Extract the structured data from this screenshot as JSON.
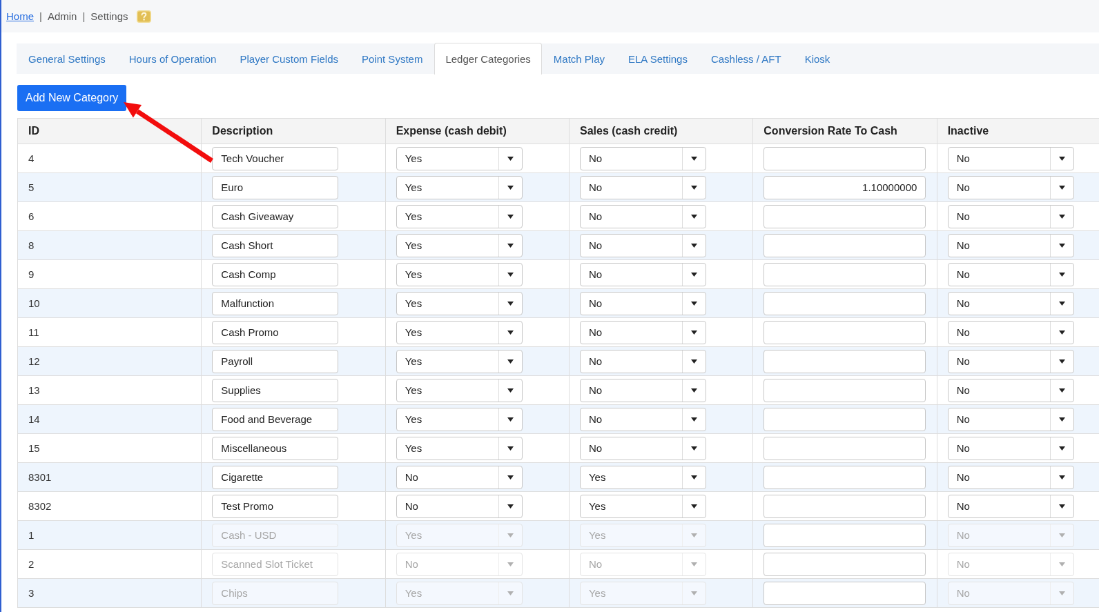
{
  "breadcrumb": [
    {
      "kind": "link",
      "label": "Home"
    },
    {
      "kind": "separator",
      "label": "|"
    },
    {
      "kind": "text",
      "label": "Admin"
    },
    {
      "kind": "separator",
      "label": "|"
    },
    {
      "kind": "text",
      "label": "Settings"
    },
    {
      "kind": "help"
    }
  ],
  "tabs": [
    {
      "label": "General Settings",
      "selected": false
    },
    {
      "label": "Hours of Operation",
      "selected": false
    },
    {
      "label": "Player Custom Fields",
      "selected": false
    },
    {
      "label": "Point System",
      "selected": false
    },
    {
      "label": "Ledger Categories",
      "selected": true
    },
    {
      "label": "Match Play",
      "selected": false
    },
    {
      "label": "ELA Settings",
      "selected": false
    },
    {
      "label": "Cashless / AFT",
      "selected": false
    },
    {
      "label": "Kiosk",
      "selected": false
    }
  ],
  "add_button": {
    "label": "Add New Category"
  },
  "table": {
    "columns": [
      "ID",
      "Description",
      "Expense (cash debit)",
      "Sales (cash credit)",
      "Conversion Rate To Cash",
      "Inactive"
    ],
    "rows": [
      {
        "id": "4",
        "description": "Tech Voucher",
        "expense": "Yes",
        "sales": "No",
        "inactive": "No",
        "disabled": false
      },
      {
        "id": "5",
        "description": "Euro",
        "expense": "Yes",
        "sales": "No",
        "conversion_rate": "1.10000000",
        "inactive": "No",
        "disabled": false
      },
      {
        "id": "6",
        "description": "Cash Giveaway",
        "expense": "Yes",
        "sales": "No",
        "inactive": "No",
        "disabled": false
      },
      {
        "id": "8",
        "description": "Cash Short",
        "expense": "Yes",
        "sales": "No",
        "inactive": "No",
        "disabled": false
      },
      {
        "id": "9",
        "description": "Cash Comp",
        "expense": "Yes",
        "sales": "No",
        "inactive": "No",
        "disabled": false
      },
      {
        "id": "10",
        "description": "Malfunction",
        "expense": "Yes",
        "sales": "No",
        "inactive": "No",
        "disabled": false
      },
      {
        "id": "11",
        "description": "Cash Promo",
        "expense": "Yes",
        "sales": "No",
        "inactive": "No",
        "disabled": false
      },
      {
        "id": "12",
        "description": "Payroll",
        "expense": "Yes",
        "sales": "No",
        "inactive": "No",
        "disabled": false
      },
      {
        "id": "13",
        "description": "Supplies",
        "expense": "Yes",
        "sales": "No",
        "inactive": "No",
        "disabled": false
      },
      {
        "id": "14",
        "description": "Food and Beverage",
        "expense": "Yes",
        "sales": "No",
        "inactive": "No",
        "disabled": false
      },
      {
        "id": "15",
        "description": "Miscellaneous",
        "expense": "Yes",
        "sales": "No",
        "inactive": "No",
        "disabled": false
      },
      {
        "id": "8301",
        "description": "Cigarette",
        "expense": "No",
        "sales": "Yes",
        "inactive": "No",
        "disabled": false
      },
      {
        "id": "8302",
        "description": "Test Promo",
        "expense": "No",
        "sales": "Yes",
        "inactive": "No",
        "disabled": false
      },
      {
        "id": "1",
        "description": "Cash - USD",
        "expense": "Yes",
        "sales": "Yes",
        "inactive": "No",
        "disabled": true
      },
      {
        "id": "2",
        "description": "Scanned Slot Ticket",
        "expense": "No",
        "sales": "No",
        "inactive": "No",
        "disabled": true
      },
      {
        "id": "3",
        "description": "Chips",
        "expense": "Yes",
        "sales": "Yes",
        "inactive": "No",
        "disabled": true
      }
    ]
  }
}
